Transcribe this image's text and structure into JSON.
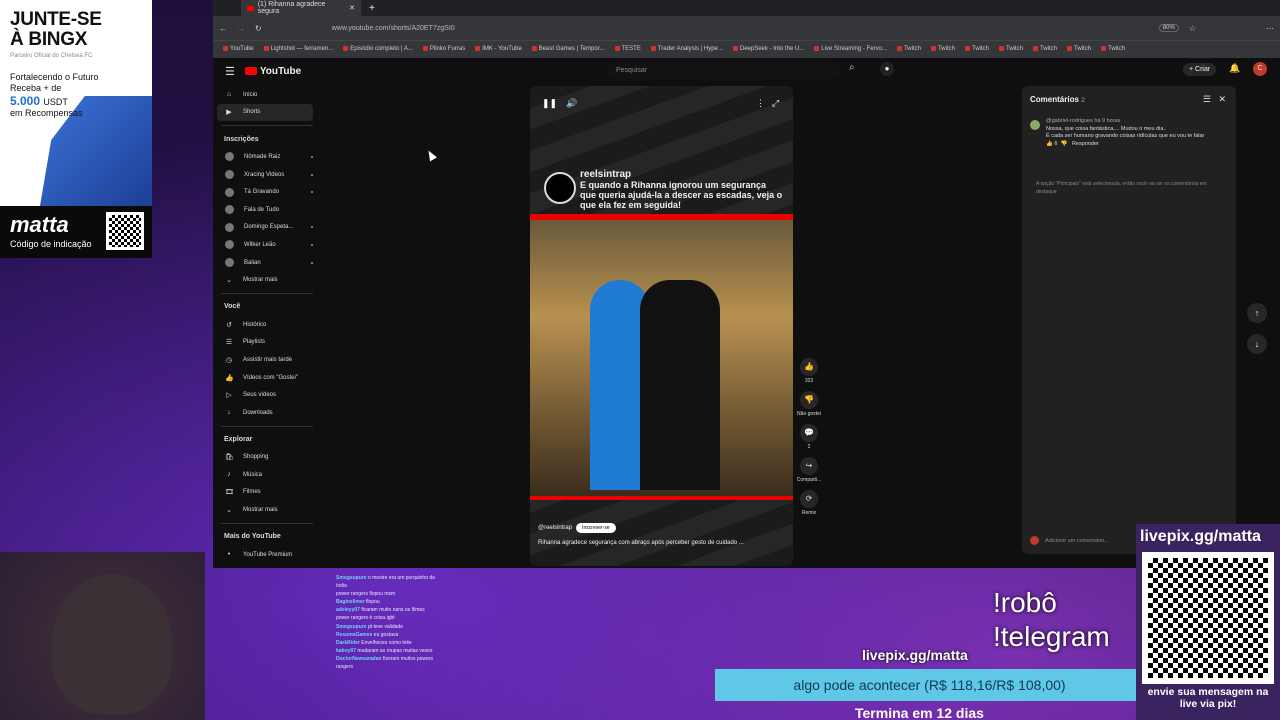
{
  "ad": {
    "headline": "JUNTE-SE\nÀ BINGX",
    "sub": "Parceiro Oficial do Chelsea FC",
    "line1": "Fortalecendo o Futuro",
    "line2": "Receba + de",
    "amount": "5.000",
    "currency": "USDT",
    "line3": "em Recompensas",
    "brand": "matta",
    "code": "Código de indicação"
  },
  "browser": {
    "tab_title": "(1) Rihanna agradece segura",
    "url": "www.youtube.com/shorts/A20ET7zgSI0",
    "zoom": "80%",
    "bookmarks": [
      "YouTube",
      "Lightshot — ferramen...",
      "Episódio completo | A...",
      "Plinko Furras",
      "IMK - YouTube",
      "Beast Games | Tempor...",
      "TESTE",
      "Trader Analysis | Hype...",
      "DeepSeek - Into the U...",
      "Live Streaming - Fervo...",
      "Twitch",
      "Twitch",
      "Twitch",
      "Twitch",
      "Twitch",
      "Twitch",
      "Twitch"
    ]
  },
  "youtube": {
    "logo": "YouTube",
    "search_placeholder": "Pesquisar",
    "create": "Criar",
    "avatar": "C"
  },
  "sidebar": {
    "main": [
      {
        "label": "Início",
        "icon": "home-icon"
      },
      {
        "label": "Shorts",
        "icon": "shorts-icon"
      }
    ],
    "subs_header": "Inscrições",
    "subs": [
      "Nômade Raiz",
      "Xracing Videos",
      "Tá Gravando",
      "Fala de Tudo",
      "Domingo Espeta...",
      "Wilker Leão",
      "Balian",
      "Mostrar mais"
    ],
    "you_header": "Você",
    "you": [
      "Histórico",
      "Playlists",
      "Assistir mais tarde",
      "Vídeos com \"Gostei\"",
      "Seus vídeos",
      "Downloads"
    ],
    "explore_header": "Explorar",
    "explore": [
      "Shopping",
      "Música",
      "Filmes",
      "Mostrar mais"
    ],
    "more_header": "Mais do YouTube",
    "premium": "YouTube Premium"
  },
  "video": {
    "channel_overlay": "reelsintrap",
    "caption": "E quando a Rihanna ignorou um segurança que queria ajudá-la a descer as escadas, veja o que ela fez em seguida!",
    "channel": "@reelsintrap",
    "subscribe": "Inscrever-se",
    "description": "Rihanna agradece segurança com abraço após perceber gesto de cuidado ..."
  },
  "actions": {
    "likes": "323",
    "dislike": "Não gostei",
    "comments": "2",
    "share": "Comparti...",
    "remix": "Remix"
  },
  "comments": {
    "title": "Comentários",
    "count": "2",
    "user": "@gabriel-rodrigues",
    "time": "há 9 horas",
    "text": "Nossa, que coisa fantástica.... Mudou o meu dia..\nÉ cada ser humano gravando coisas ridículas que eu vou te falar",
    "likes": "6",
    "reply": "Responder",
    "note": "A opção \"Principais\" está selecionada, então você vai ver os comentários em destaque",
    "add_placeholder": "Adicione um comentário..."
  },
  "stream": {
    "chat": [
      {
        "user": "Smogsupure",
        "msg": "o mestre era um porquinho da índia"
      },
      {
        "user": "",
        "msg": "power rangers flopou msm"
      },
      {
        "user": "Baginslimer",
        "msg": "flopou"
      },
      {
        "user": "adeleyy07",
        "msg": "ficaram muito ruins os filmes"
      },
      {
        "user": "",
        "msg": "power rangers é coisa igbt"
      },
      {
        "user": "Smogsupure",
        "msg": "pt teve validade"
      },
      {
        "user": "ResumoGames",
        "msg": "eu gostava"
      },
      {
        "user": "DarkRider",
        "msg": "Envelheceu como leite"
      },
      {
        "user": "kaboy07",
        "msg": "mudaram as roupas muitas vezes"
      },
      {
        "user": "DoctorNewsaradan",
        "msg": "fizeram muitos powers rangers"
      }
    ],
    "livepix": "livepix.gg/matta",
    "robo": "!robô",
    "telegram": "!telegram",
    "goal": "algo pode acontecer (R$ 118,16/R$ 108,00)",
    "ends": "Termina em 12 dias",
    "qr_title": "livepix.gg/matta",
    "qr_bottom": "envie sua mensagem na live via pix!"
  }
}
